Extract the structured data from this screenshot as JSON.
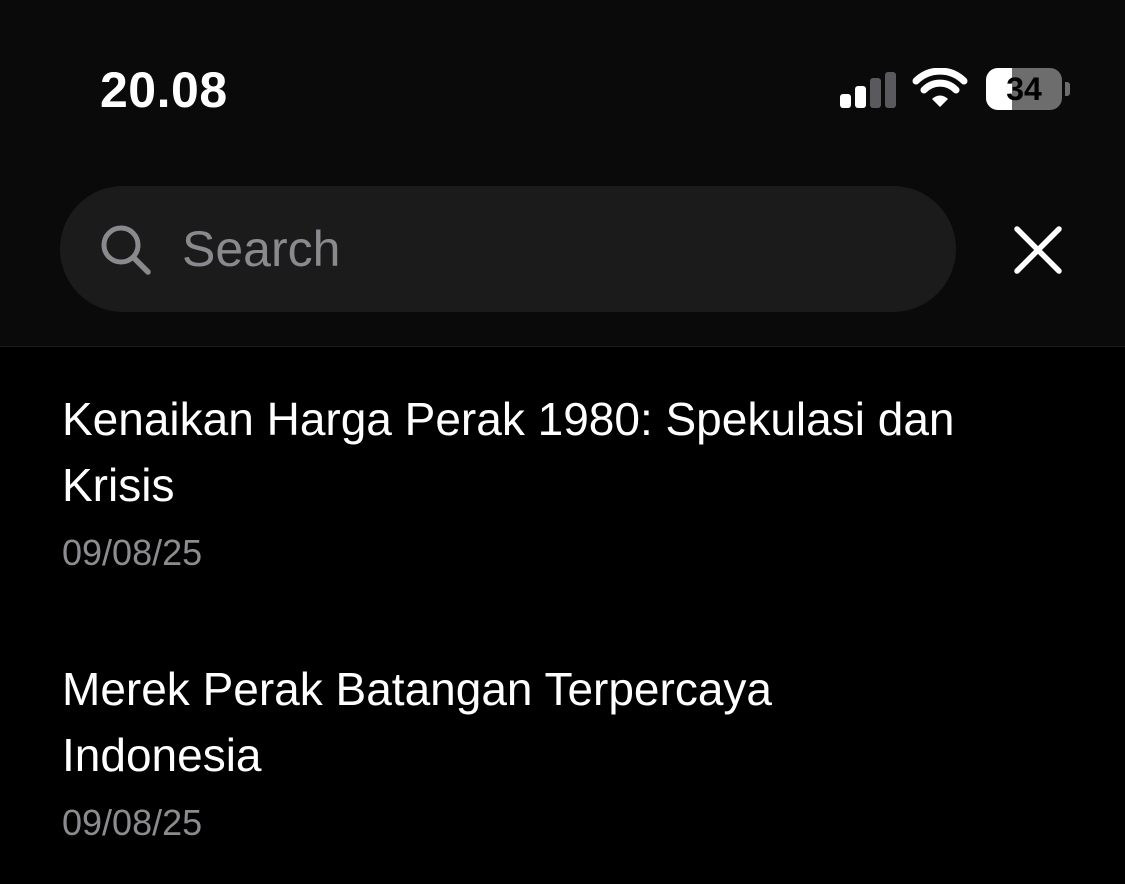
{
  "status_bar": {
    "time": "20.08",
    "signal_icon": "cellular-signal-icon",
    "wifi_icon": "wifi-icon",
    "battery_level": 34,
    "battery_label": "34"
  },
  "search": {
    "placeholder": "Search",
    "value": "",
    "search_icon": "search-icon",
    "close_icon": "close-icon"
  },
  "results": [
    {
      "title": "Kenaikan Harga Perak 1980: Spekulasi dan Krisis",
      "date": "09/08/25"
    },
    {
      "title": "Merek Perak Batangan Terpercaya Indonesia",
      "date": "09/08/25"
    }
  ],
  "colors": {
    "background": "#000000",
    "header_background": "#0a0a0a",
    "search_field": "#1b1b1b",
    "placeholder": "#8a8a8e",
    "secondary_text": "#8c8c90",
    "inactive_signal": "#5a5a5e"
  }
}
